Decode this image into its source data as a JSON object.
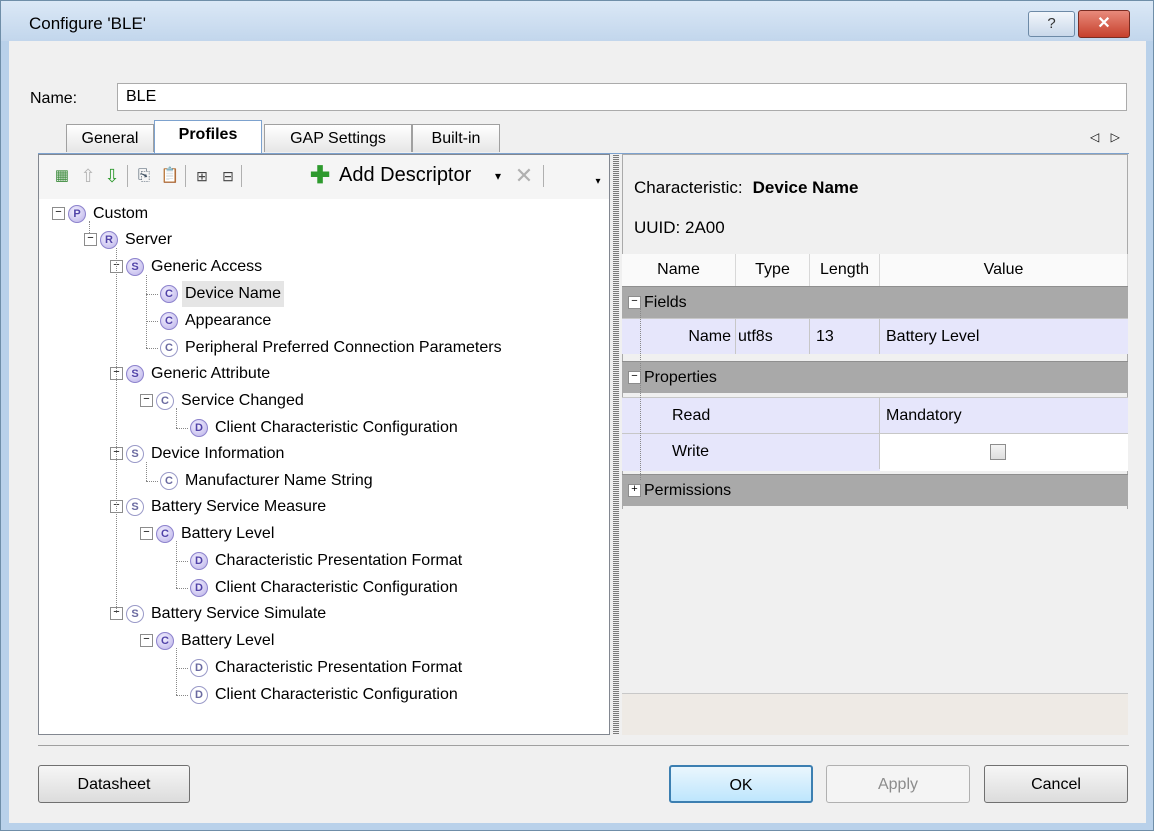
{
  "window": {
    "title": "Configure 'BLE'",
    "help": "?",
    "close": "✕"
  },
  "name_field": {
    "label": "Name:",
    "value": "BLE"
  },
  "tabs": [
    {
      "label": "General"
    },
    {
      "label": "Profiles",
      "active": true
    },
    {
      "label": "GAP Settings"
    },
    {
      "label": "Built-in"
    }
  ],
  "tab_nav": "◁ ▷",
  "toolbar": {
    "add_descriptor": "Add Descriptor"
  },
  "tree": [
    {
      "badge": "P",
      "label": "Custom"
    },
    {
      "badge": "R",
      "label": "Server"
    },
    {
      "badge": "S",
      "label": "Generic Access"
    },
    {
      "badge": "C",
      "label": "Device Name",
      "selected": true
    },
    {
      "badge": "C",
      "label": "Appearance"
    },
    {
      "badge": "C",
      "label": "Peripheral Preferred Connection Parameters"
    },
    {
      "badge": "S",
      "label": "Generic Attribute"
    },
    {
      "badge": "C",
      "label": "Service Changed"
    },
    {
      "badge": "D",
      "label": "Client Characteristic Configuration"
    },
    {
      "badge": "S",
      "label": "Device Information"
    },
    {
      "badge": "C",
      "label": "Manufacturer Name String"
    },
    {
      "badge": "S",
      "label": "Battery Service Measure"
    },
    {
      "badge": "C",
      "label": "Battery Level"
    },
    {
      "badge": "D",
      "label": "Characteristic Presentation Format"
    },
    {
      "badge": "D",
      "label": "Client Characteristic Configuration"
    },
    {
      "badge": "S",
      "label": "Battery Service Simulate"
    },
    {
      "badge": "C",
      "label": "Battery Level"
    },
    {
      "badge": "D",
      "label": "Characteristic Presentation Format"
    },
    {
      "badge": "D",
      "label": "Client Characteristic Configuration"
    }
  ],
  "details": {
    "char_label": "Characteristic:",
    "char_name": "Device Name",
    "uuid": "UUID: 2A00",
    "columns": [
      "Name",
      "Type",
      "Length",
      "Value"
    ],
    "groups": {
      "fields": "Fields",
      "properties": "Properties",
      "permissions": "Permissions"
    },
    "field_row": {
      "name": "Name",
      "type": "utf8s",
      "length": "13",
      "value": "Battery Level"
    },
    "read_row": {
      "name": "Read",
      "value": "Mandatory"
    },
    "write_row": {
      "name": "Write",
      "checked": false
    }
  },
  "buttons": {
    "datasheet": "Datasheet",
    "ok": "OK",
    "apply": "Apply",
    "cancel": "Cancel"
  }
}
